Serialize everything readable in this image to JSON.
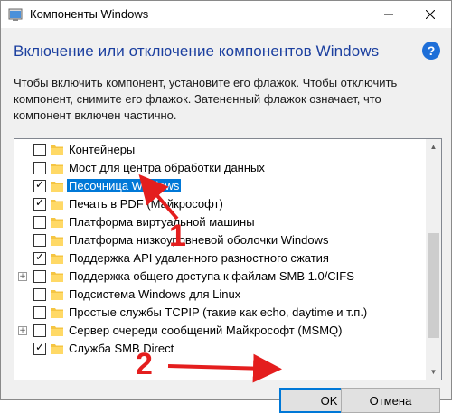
{
  "window": {
    "title": "Компоненты Windows",
    "heading": "Включение или отключение компонентов Windows",
    "help_label": "?",
    "description": "Чтобы включить компонент, установите его флажок. Чтобы отключить компонент, снимите его флажок. Затененный флажок означает, что компонент включен частично."
  },
  "features": [
    {
      "label": "Контейнеры",
      "checked": false,
      "expandable": false
    },
    {
      "label": "Мост для центра обработки данных",
      "checked": false,
      "expandable": false
    },
    {
      "label": "Песочница Windows",
      "checked": true,
      "expandable": false,
      "selected": true
    },
    {
      "label": "Печать в PDF (Майкрософт)",
      "checked": true,
      "expandable": false
    },
    {
      "label": "Платформа виртуальной машины",
      "checked": false,
      "expandable": false
    },
    {
      "label": "Платформа низкоуровневой оболочки Windows",
      "checked": false,
      "expandable": false
    },
    {
      "label": "Поддержка API удаленного разностного сжатия",
      "checked": true,
      "expandable": false
    },
    {
      "label": "Поддержка общего доступа к файлам SMB 1.0/CIFS",
      "checked": false,
      "expandable": true
    },
    {
      "label": "Подсистема Windows для Linux",
      "checked": false,
      "expandable": false
    },
    {
      "label": "Простые службы TCPIP (такие как echo, daytime и т.п.)",
      "checked": false,
      "expandable": false
    },
    {
      "label": "Сервер очереди сообщений Майкрософт (MSMQ)",
      "checked": false,
      "expandable": true
    },
    {
      "label": "Служба SMB Direct",
      "checked": true,
      "expandable": false
    }
  ],
  "buttons": {
    "ok": "OK",
    "cancel": "Отмена"
  },
  "annotations": {
    "step1": "1",
    "step2": "2"
  },
  "colors": {
    "annotation": "#e41e1e",
    "selection": "#0078d7",
    "heading": "#1b3f9f",
    "folder": "#f5c542"
  },
  "icons": {
    "app": "windows-features-icon",
    "folder": "folder-icon",
    "help": "help-icon"
  }
}
